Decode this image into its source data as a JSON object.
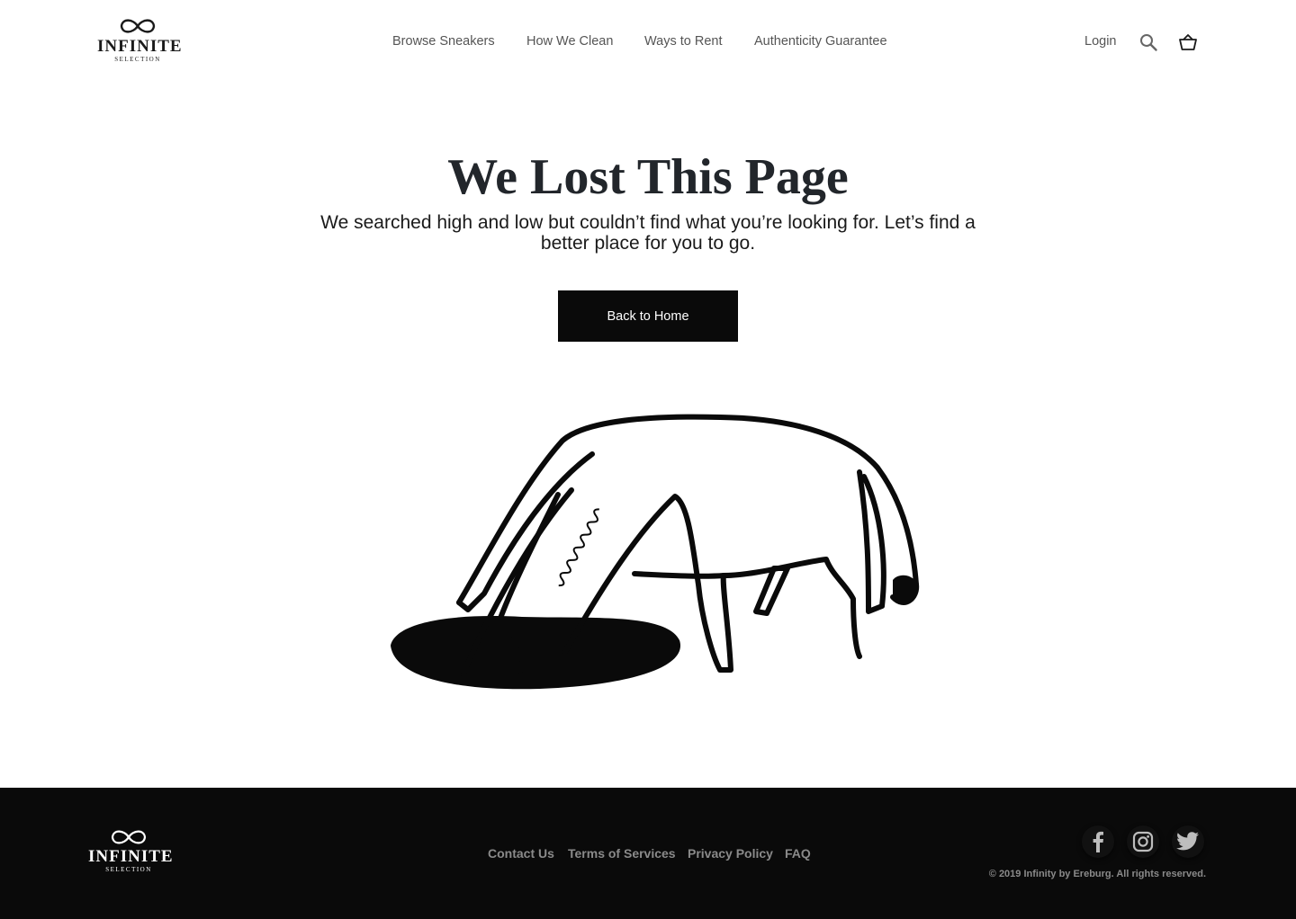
{
  "header": {
    "logo": {
      "wordmark": "INFINITE",
      "subline": "SELECTION"
    },
    "nav": [
      {
        "label": "Browse Sneakers"
      },
      {
        "label": "How We Clean"
      },
      {
        "label": "Ways to Rent"
      },
      {
        "label": "Authenticity Guarantee"
      }
    ],
    "login_label": "Login",
    "icons": {
      "search": "search-icon",
      "cart": "basket-icon"
    }
  },
  "main": {
    "title": "We Lost This Page",
    "subtitle": "We searched high and low but couldn’t find what you’re looking for. Let’s find a better place for you to go.",
    "button_label": "Back to Home",
    "illustration": "sneaker-in-hole-illustration"
  },
  "footer": {
    "logo": {
      "wordmark": "INFINITE",
      "subline": "SELECTION"
    },
    "links": [
      {
        "label": "Contact Us"
      },
      {
        "label": "Terms of Services"
      },
      {
        "label": "Privacy Policy"
      },
      {
        "label": "FAQ"
      }
    ],
    "social": [
      "facebook-icon",
      "instagram-icon",
      "twitter-icon"
    ],
    "copyright": "© 2019 Infinity by Ereburg. All rights reserved."
  },
  "colors": {
    "background": "#ffffff",
    "text": "#1a1a1a",
    "nav_text": "#555555",
    "button_bg": "#0a0a0a",
    "footer_bg": "#0a0a0a",
    "footer_text": "#8a8a8a"
  }
}
